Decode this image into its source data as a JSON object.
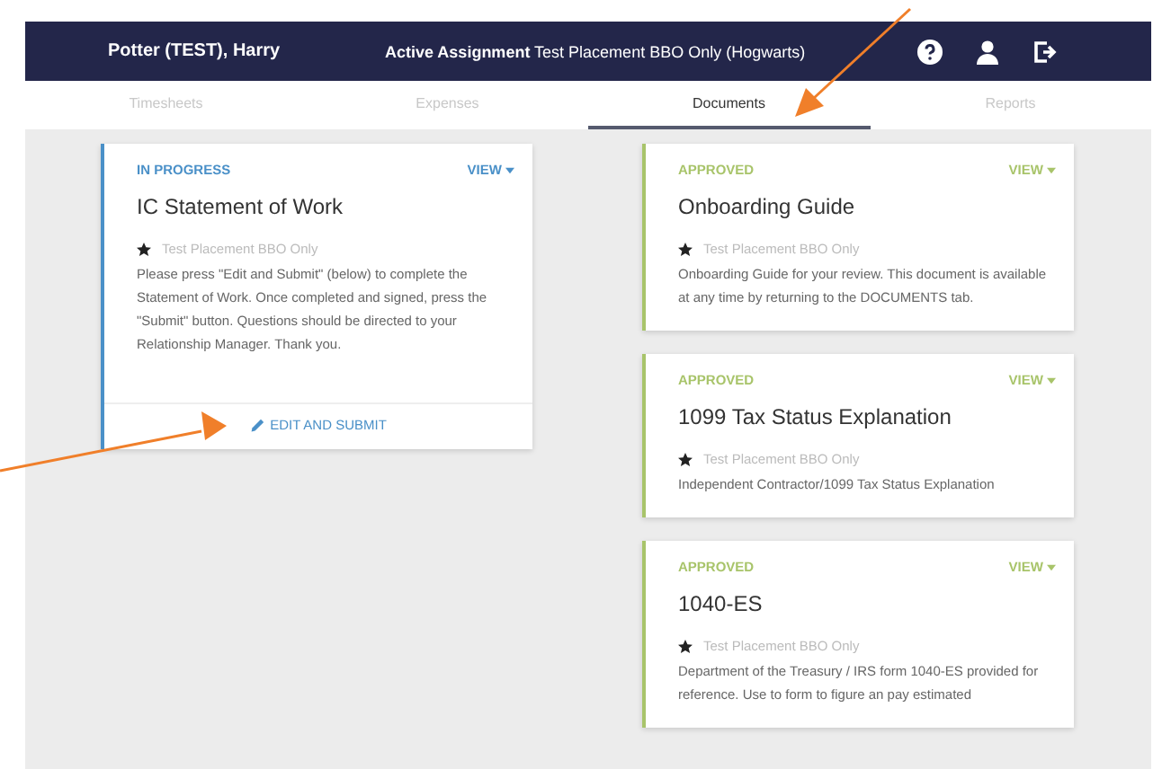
{
  "header": {
    "user_name": "Potter (TEST), Harry",
    "assignment_label": "Active Assignment",
    "assignment_value": "Test Placement BBO Only (Hogwarts)"
  },
  "tabs": [
    {
      "label": "Timesheets",
      "selected": false
    },
    {
      "label": "Expenses",
      "selected": false
    },
    {
      "label": "Documents",
      "selected": true
    },
    {
      "label": "Reports",
      "selected": false
    }
  ],
  "columns": [
    {
      "cards": [
        {
          "status": "IN PROGRESS",
          "color": "#4a90c8",
          "view": "VIEW",
          "title": "IC Statement of Work",
          "placement": "Test Placement BBO Only",
          "description": "Please press \"Edit and Submit\" (below) to complete the Statement of Work. Once completed and signed, press the \"Submit\" button. Questions should be directed to your Relationship Manager. Thank you.",
          "action": "EDIT AND SUBMIT"
        }
      ]
    },
    {
      "cards": [
        {
          "status": "APPROVED",
          "color": "#a8c46a",
          "view": "VIEW",
          "title": "Onboarding Guide",
          "placement": "Test Placement BBO Only",
          "description": "Onboarding Guide for your review. This document is available at any time by returning to the DOCUMENTS tab."
        },
        {
          "status": "APPROVED",
          "color": "#a8c46a",
          "view": "VIEW",
          "title": "1099 Tax Status Explanation",
          "placement": "Test Placement BBO Only",
          "description": "Independent Contractor/1099 Tax Status Explanation"
        },
        {
          "status": "APPROVED",
          "color": "#a8c46a",
          "view": "VIEW",
          "title": "1040-ES",
          "placement": "Test Placement BBO Only",
          "description": "Department of the Treasury / IRS form 1040-ES provided for reference. Use to form to figure an pay estimated"
        }
      ]
    }
  ]
}
